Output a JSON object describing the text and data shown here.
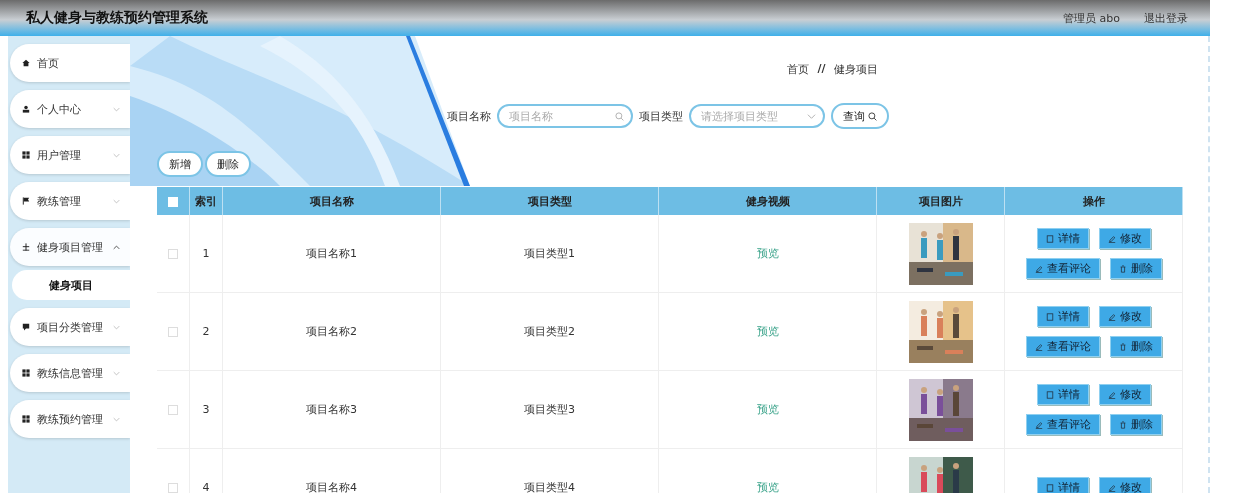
{
  "header": {
    "title": "私人健身与教练预约管理系统",
    "user": "管理员 abo",
    "logout": "退出登录"
  },
  "sidebar": {
    "items": [
      {
        "label": "首页"
      },
      {
        "label": "个人中心",
        "expanded": false
      },
      {
        "label": "用户管理",
        "expanded": false
      },
      {
        "label": "教练管理",
        "expanded": false
      },
      {
        "label": "健身项目管理",
        "expanded": true,
        "children": [
          {
            "label": "健身项目",
            "selected": true
          }
        ]
      },
      {
        "label": "项目分类管理",
        "expanded": false
      },
      {
        "label": "教练信息管理",
        "expanded": false
      },
      {
        "label": "教练预约管理",
        "expanded": false
      }
    ]
  },
  "breadcrumb": [
    "首页",
    "//",
    "健身项目"
  ],
  "search": {
    "name_label": "项目名称",
    "name_placeholder": "项目名称",
    "type_label": "项目类型",
    "type_placeholder": "请选择项目类型",
    "query_button": "查询"
  },
  "actions": [
    "新增",
    "删除"
  ],
  "table": {
    "all_checked": false,
    "columns": [
      "索引",
      "项目名称",
      "项目类型",
      "健身视频",
      "项目图片",
      "操作"
    ],
    "rows": [
      {
        "checked": false,
        "index": "1",
        "name": "项目名称1",
        "type": "项目类型1",
        "video": "预览",
        "buttons": [
          "详情",
          "修改",
          "查看评论",
          "删除"
        ]
      },
      {
        "checked": false,
        "index": "2",
        "name": "项目名称2",
        "type": "项目类型2",
        "video": "预览",
        "buttons": [
          "详情",
          "修改",
          "查看评论",
          "删除"
        ]
      },
      {
        "checked": false,
        "index": "3",
        "name": "项目名称3",
        "type": "项目类型3",
        "video": "预览",
        "buttons": [
          "详情",
          "修改",
          "查看评论",
          "删除"
        ]
      },
      {
        "checked": false,
        "index": "4",
        "name": "项目名称4",
        "type": "项目类型4",
        "video": "预览",
        "buttons": [
          "详情",
          "修改"
        ]
      }
    ]
  }
}
